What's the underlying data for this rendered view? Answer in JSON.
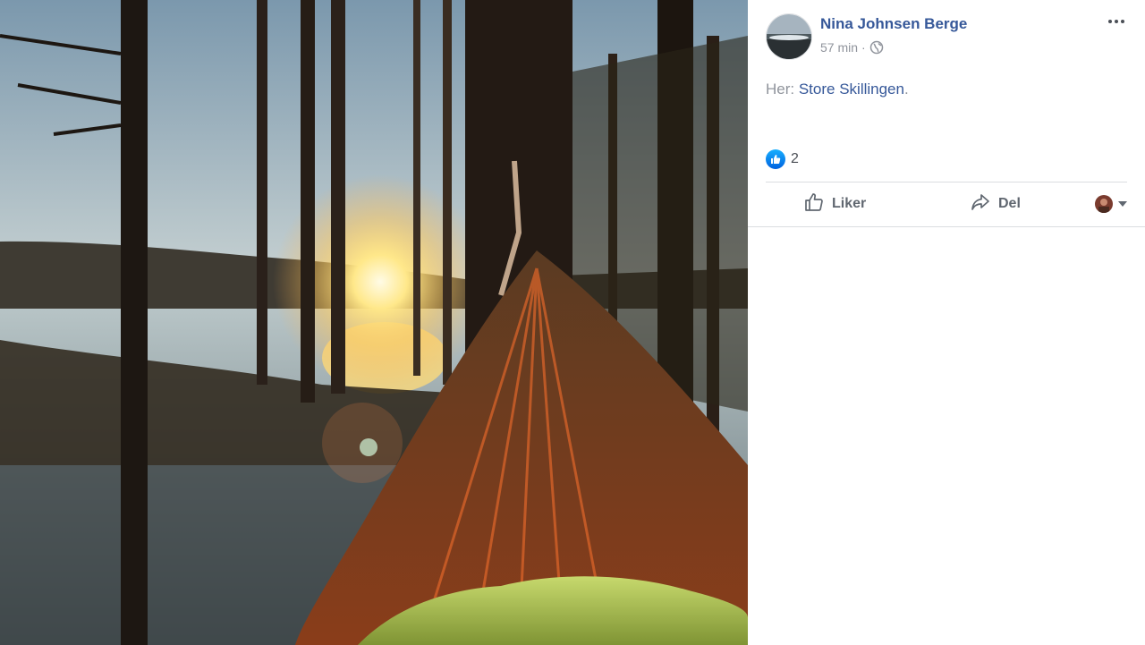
{
  "post": {
    "author_name": "Nina Johnsen Berge",
    "time": "57 min",
    "separator": "·",
    "location_prefix": "Her: ",
    "location_name": "Store Skillingen",
    "location_suffix": "."
  },
  "reactions": {
    "count": "2"
  },
  "actions": {
    "like_label": "Liker",
    "share_label": "Del"
  },
  "icons": {
    "more": "more-options-icon",
    "privacy": "globe-icon",
    "like": "thumbs-up-icon",
    "share": "share-arrow-icon"
  },
  "colors": {
    "link": "#365899",
    "meta": "#90949c",
    "action": "#606770",
    "like_blue": "#1877f2"
  }
}
